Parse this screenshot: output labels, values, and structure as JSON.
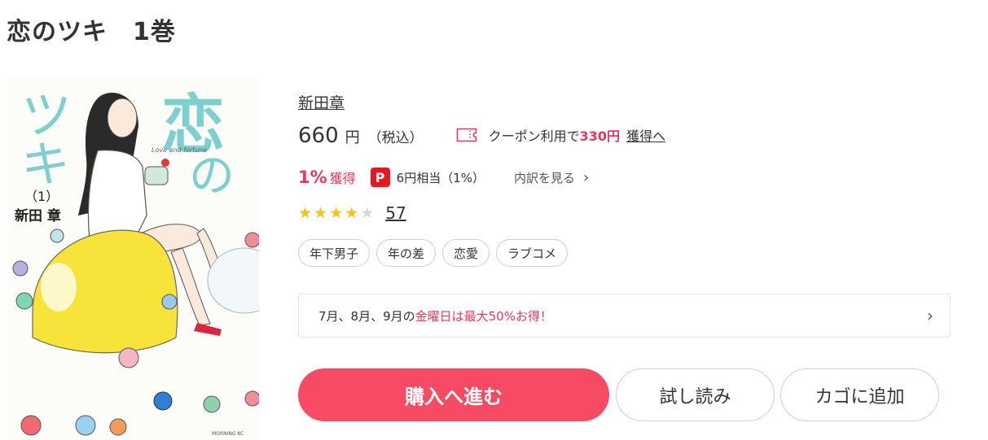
{
  "page": {
    "title": "恋のツキ　1巻"
  },
  "cover": {
    "title_chars": [
      "恋",
      "の",
      "ツ",
      "キ"
    ],
    "subtitle": "Love and fortune",
    "volume": "（1）",
    "author": "新田 章",
    "publisher": "MORNING KC",
    "accent_color": "#7ecfcf"
  },
  "book": {
    "author": "新田章",
    "price": "660",
    "price_unit": "円",
    "tax_note": "（税込）",
    "coupon": {
      "icon": "coupon-ticket-icon",
      "prefix": "クーポン利用で",
      "amount": "330円",
      "link": "獲得へ"
    },
    "points": {
      "percent": "1%",
      "label": "獲得",
      "paypay_icon": "paypay-icon",
      "paypay_glyph": "P",
      "equivalent": "6円相当（1%）",
      "breakdown": "内訳を見る",
      "breakdown_chevron": "›"
    },
    "rating": {
      "stars": 4,
      "max": 5,
      "count": "57"
    },
    "tags": [
      "年下男子",
      "年の差",
      "恋愛",
      "ラブコメ"
    ]
  },
  "banner": {
    "prefix": "7月、8月、9月の",
    "highlight": "金曜日は最大50%お得！",
    "chevron": "›"
  },
  "actions": {
    "buy": "購入へ進む",
    "trial": "試し読み",
    "cart": "カゴに追加"
  },
  "colors": {
    "accent": "#f64b63",
    "highlight": "#e8395a",
    "star": "#f2c31b"
  }
}
